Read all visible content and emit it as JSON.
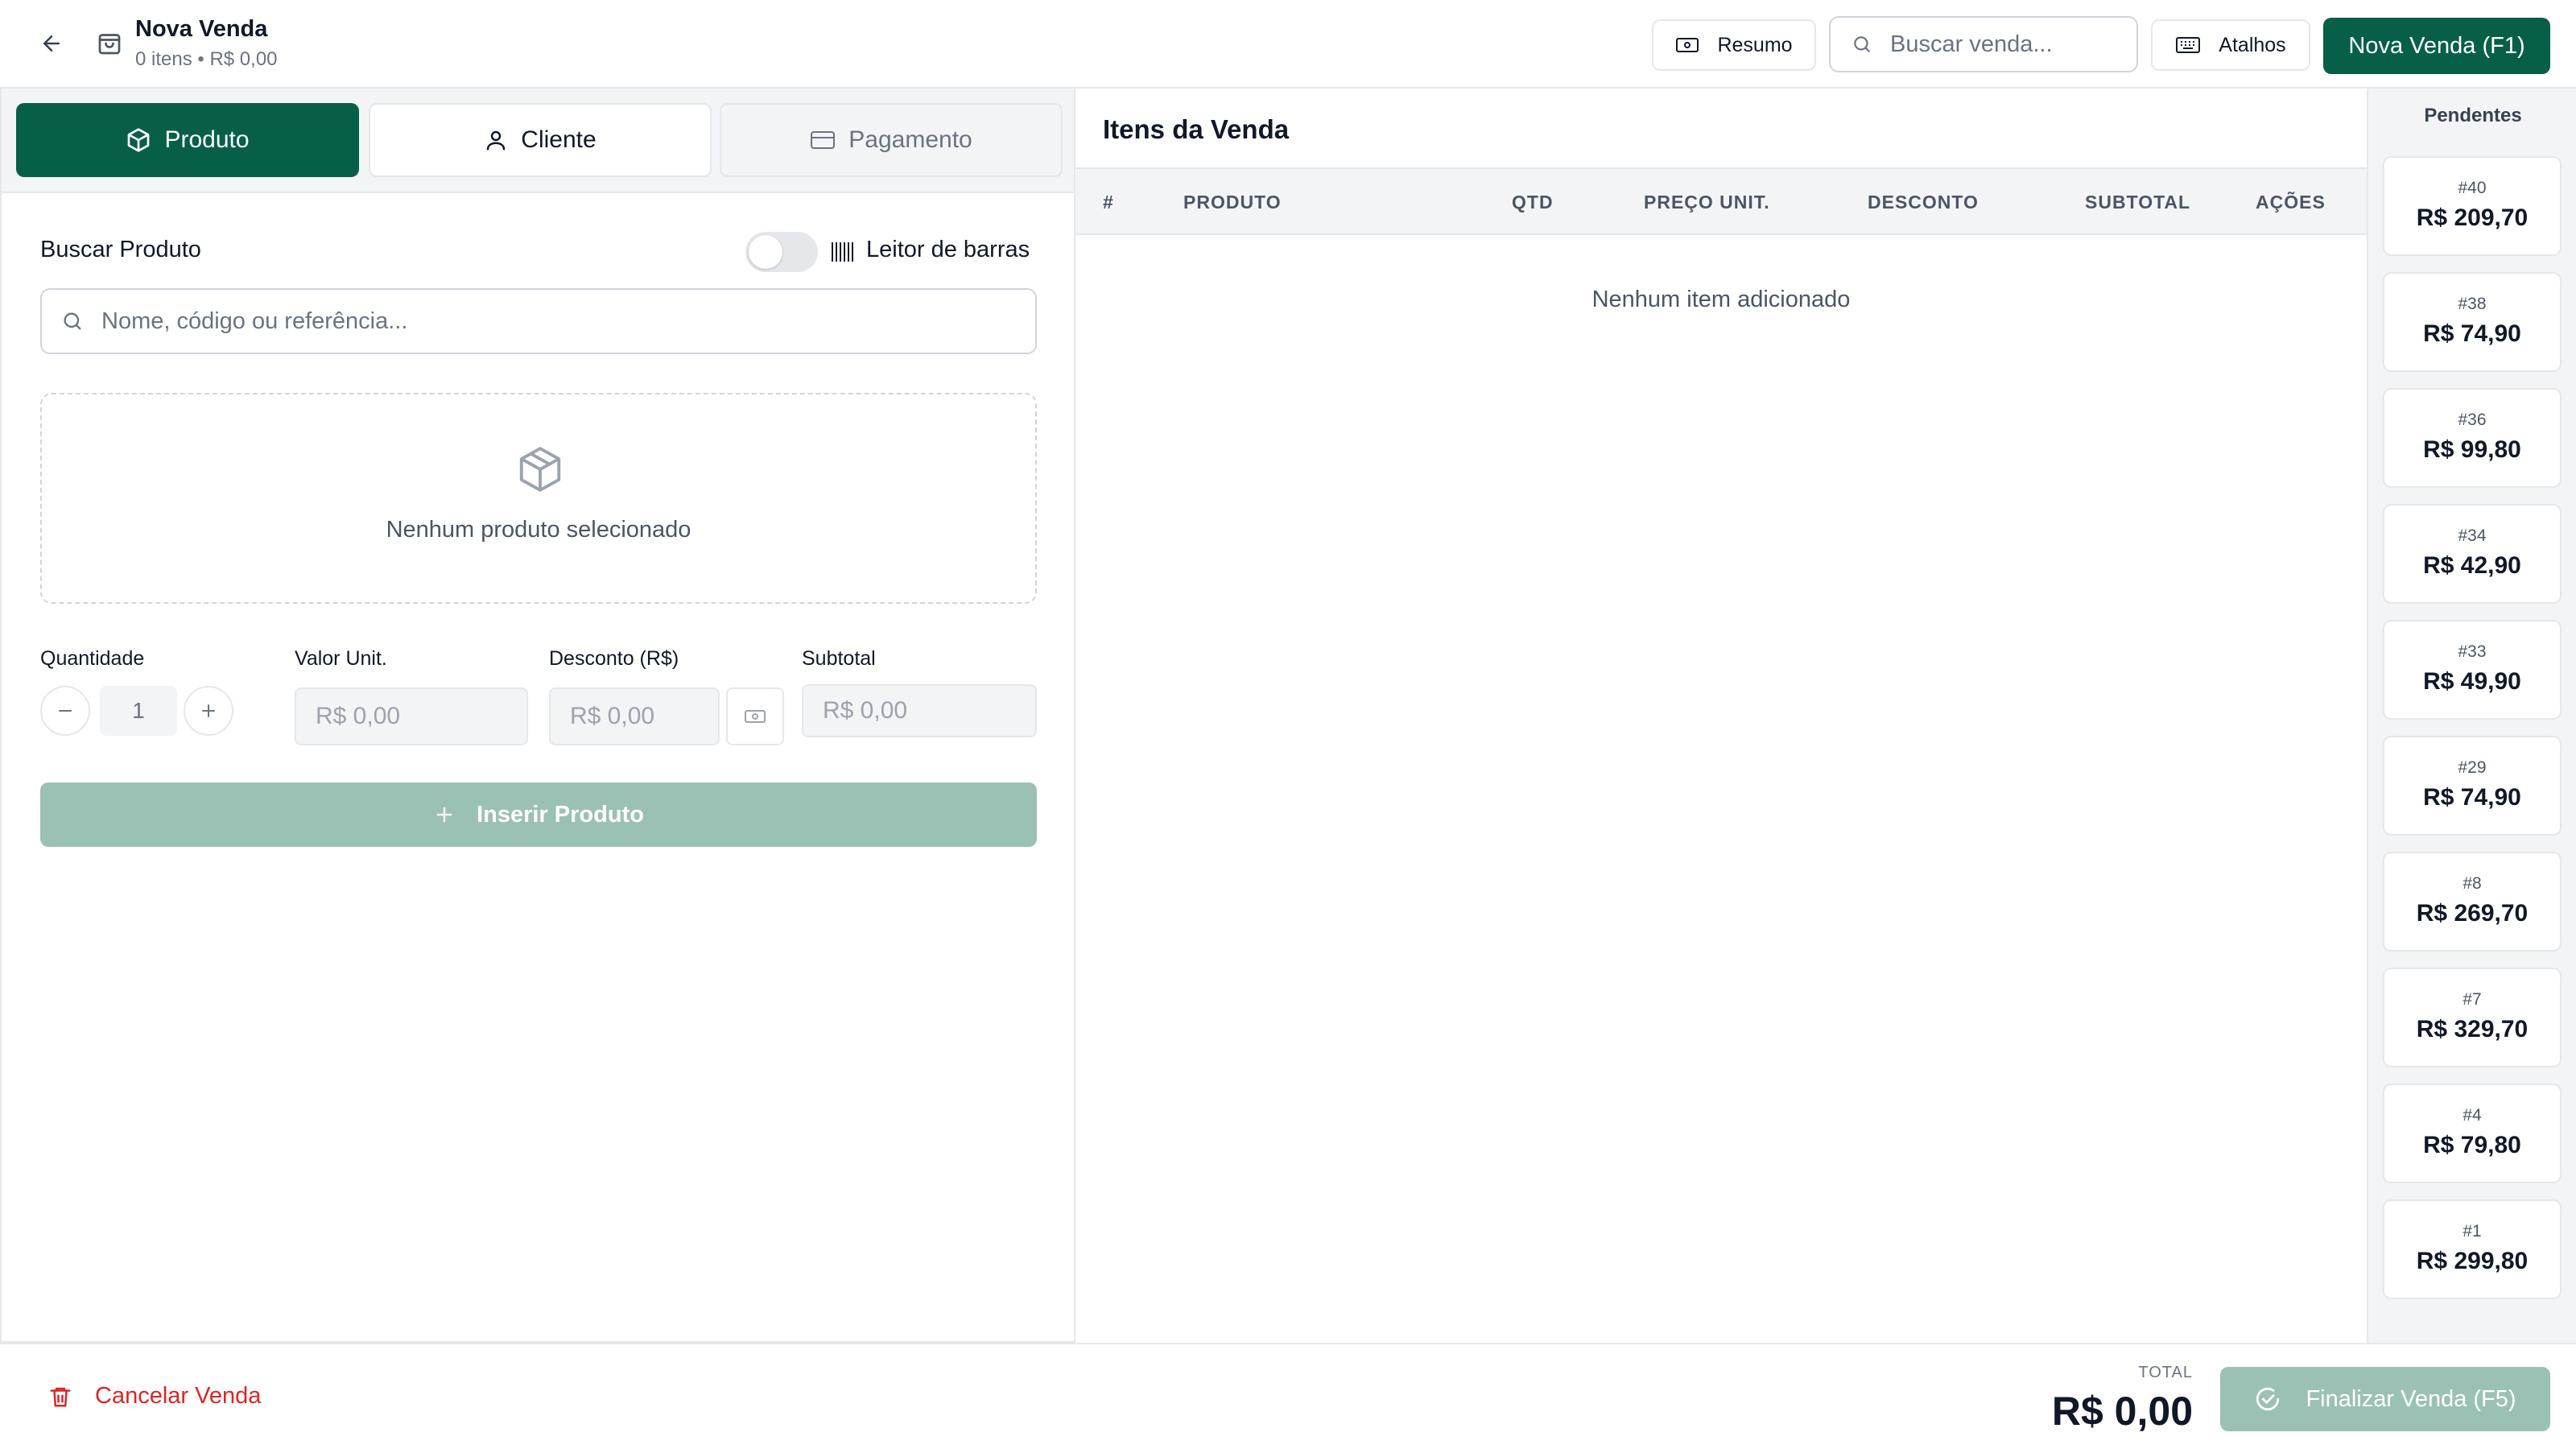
{
  "header": {
    "title": "Nova Venda",
    "subtitle": "0 itens • R$ 0,00",
    "summary_label": "Resumo",
    "search_placeholder": "Buscar venda...",
    "shortcuts_label": "Atalhos",
    "new_sale_label": "Nova Venda (F1)"
  },
  "tabs": [
    {
      "label": "Produto",
      "icon": "box-icon",
      "active": true
    },
    {
      "label": "Cliente",
      "icon": "user-icon",
      "active": false
    },
    {
      "label": "Pagamento",
      "icon": "credit-card-icon",
      "active": false
    }
  ],
  "product_form": {
    "search_label": "Buscar Produto",
    "barcode_label": "Leitor de barras",
    "barcode_enabled": false,
    "search_placeholder": "Nome, código ou referência...",
    "empty_text": "Nenhum produto selecionado",
    "quantity_label": "Quantidade",
    "quantity_value": "1",
    "unit_price_label": "Valor Unit.",
    "unit_price_placeholder": "R$ 0,00",
    "discount_label": "Desconto (R$)",
    "discount_placeholder": "R$ 0,00",
    "subtotal_label": "Subtotal",
    "subtotal_value": "R$ 0,00",
    "insert_label": "Inserir Produto"
  },
  "items_table": {
    "title": "Itens da Venda",
    "columns": [
      "#",
      "PRODUTO",
      "QTD",
      "PREÇO UNIT.",
      "DESCONTO",
      "SUBTOTAL",
      "AÇÕES"
    ],
    "empty_text": "Nenhum item adicionado"
  },
  "pending": {
    "title": "Pendentes",
    "items": [
      {
        "number": "#40",
        "value": "R$ 209,70"
      },
      {
        "number": "#38",
        "value": "R$ 74,90"
      },
      {
        "number": "#36",
        "value": "R$ 99,80"
      },
      {
        "number": "#34",
        "value": "R$ 42,90"
      },
      {
        "number": "#33",
        "value": "R$ 49,90"
      },
      {
        "number": "#29",
        "value": "R$ 74,90"
      },
      {
        "number": "#8",
        "value": "R$ 269,70"
      },
      {
        "number": "#7",
        "value": "R$ 329,70"
      },
      {
        "number": "#4",
        "value": "R$ 79,80"
      },
      {
        "number": "#1",
        "value": "R$ 299,80"
      }
    ]
  },
  "footer": {
    "cancel_label": "Cancelar Venda",
    "total_label": "TOTAL",
    "total_value": "R$ 0,00",
    "finish_label": "Finalizar Venda (F5)"
  },
  "colors": {
    "primary": "#065f46",
    "primary_disabled": "#9ac1b4",
    "danger": "#dc2626"
  }
}
